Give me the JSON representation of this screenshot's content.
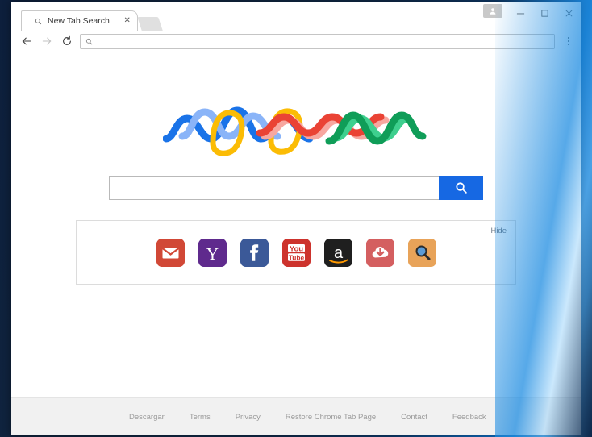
{
  "window": {
    "title": "New Tab Search",
    "controls": {
      "profile": "profile-avatar",
      "minimize": "–",
      "maximize": "□",
      "close": "✕"
    }
  },
  "tab": {
    "label": "New Tab Search",
    "favicon": "search-icon",
    "close_label": "✕",
    "new_tab_label": ""
  },
  "toolbar": {
    "back": "←",
    "forward": "→",
    "reload": "⟳",
    "menu": "⋮",
    "omnibox": {
      "value": "",
      "placeholder": "",
      "icon": "search-icon"
    }
  },
  "logo": {
    "name": "wave-ribbon-logo",
    "colors": {
      "blue_dark": "#1a73e8",
      "blue_light": "#8ab4f8",
      "yellow": "#fbbc05",
      "red_dark": "#ea4335",
      "red_light": "#f7a7a0",
      "green_dark": "#0f9d58",
      "green_light": "#3ecf8e"
    }
  },
  "search": {
    "value": "",
    "placeholder": "",
    "button_label": "search-icon",
    "button_color": "#1668e3"
  },
  "shortcuts": {
    "hide_label": "Hide",
    "tiles": [
      {
        "name": "gmail",
        "label": "Gmail",
        "color": "#d14836"
      },
      {
        "name": "yahoo",
        "label": "Yahoo",
        "color": "#5f2a8d"
      },
      {
        "name": "facebook",
        "label": "Facebook",
        "color": "#3b5998"
      },
      {
        "name": "youtube",
        "label": "YouTube",
        "color": "#cd332d"
      },
      {
        "name": "amazon",
        "label": "Amazon",
        "color": "#1f1f1f"
      },
      {
        "name": "download",
        "label": "Download",
        "color": "#d45f60"
      },
      {
        "name": "search",
        "label": "Search",
        "color": "#e8a359"
      }
    ]
  },
  "footer": {
    "links": [
      "Descargar",
      "Terms",
      "Privacy",
      "Restore Chrome Tab Page",
      "Contact",
      "Feedback"
    ]
  }
}
